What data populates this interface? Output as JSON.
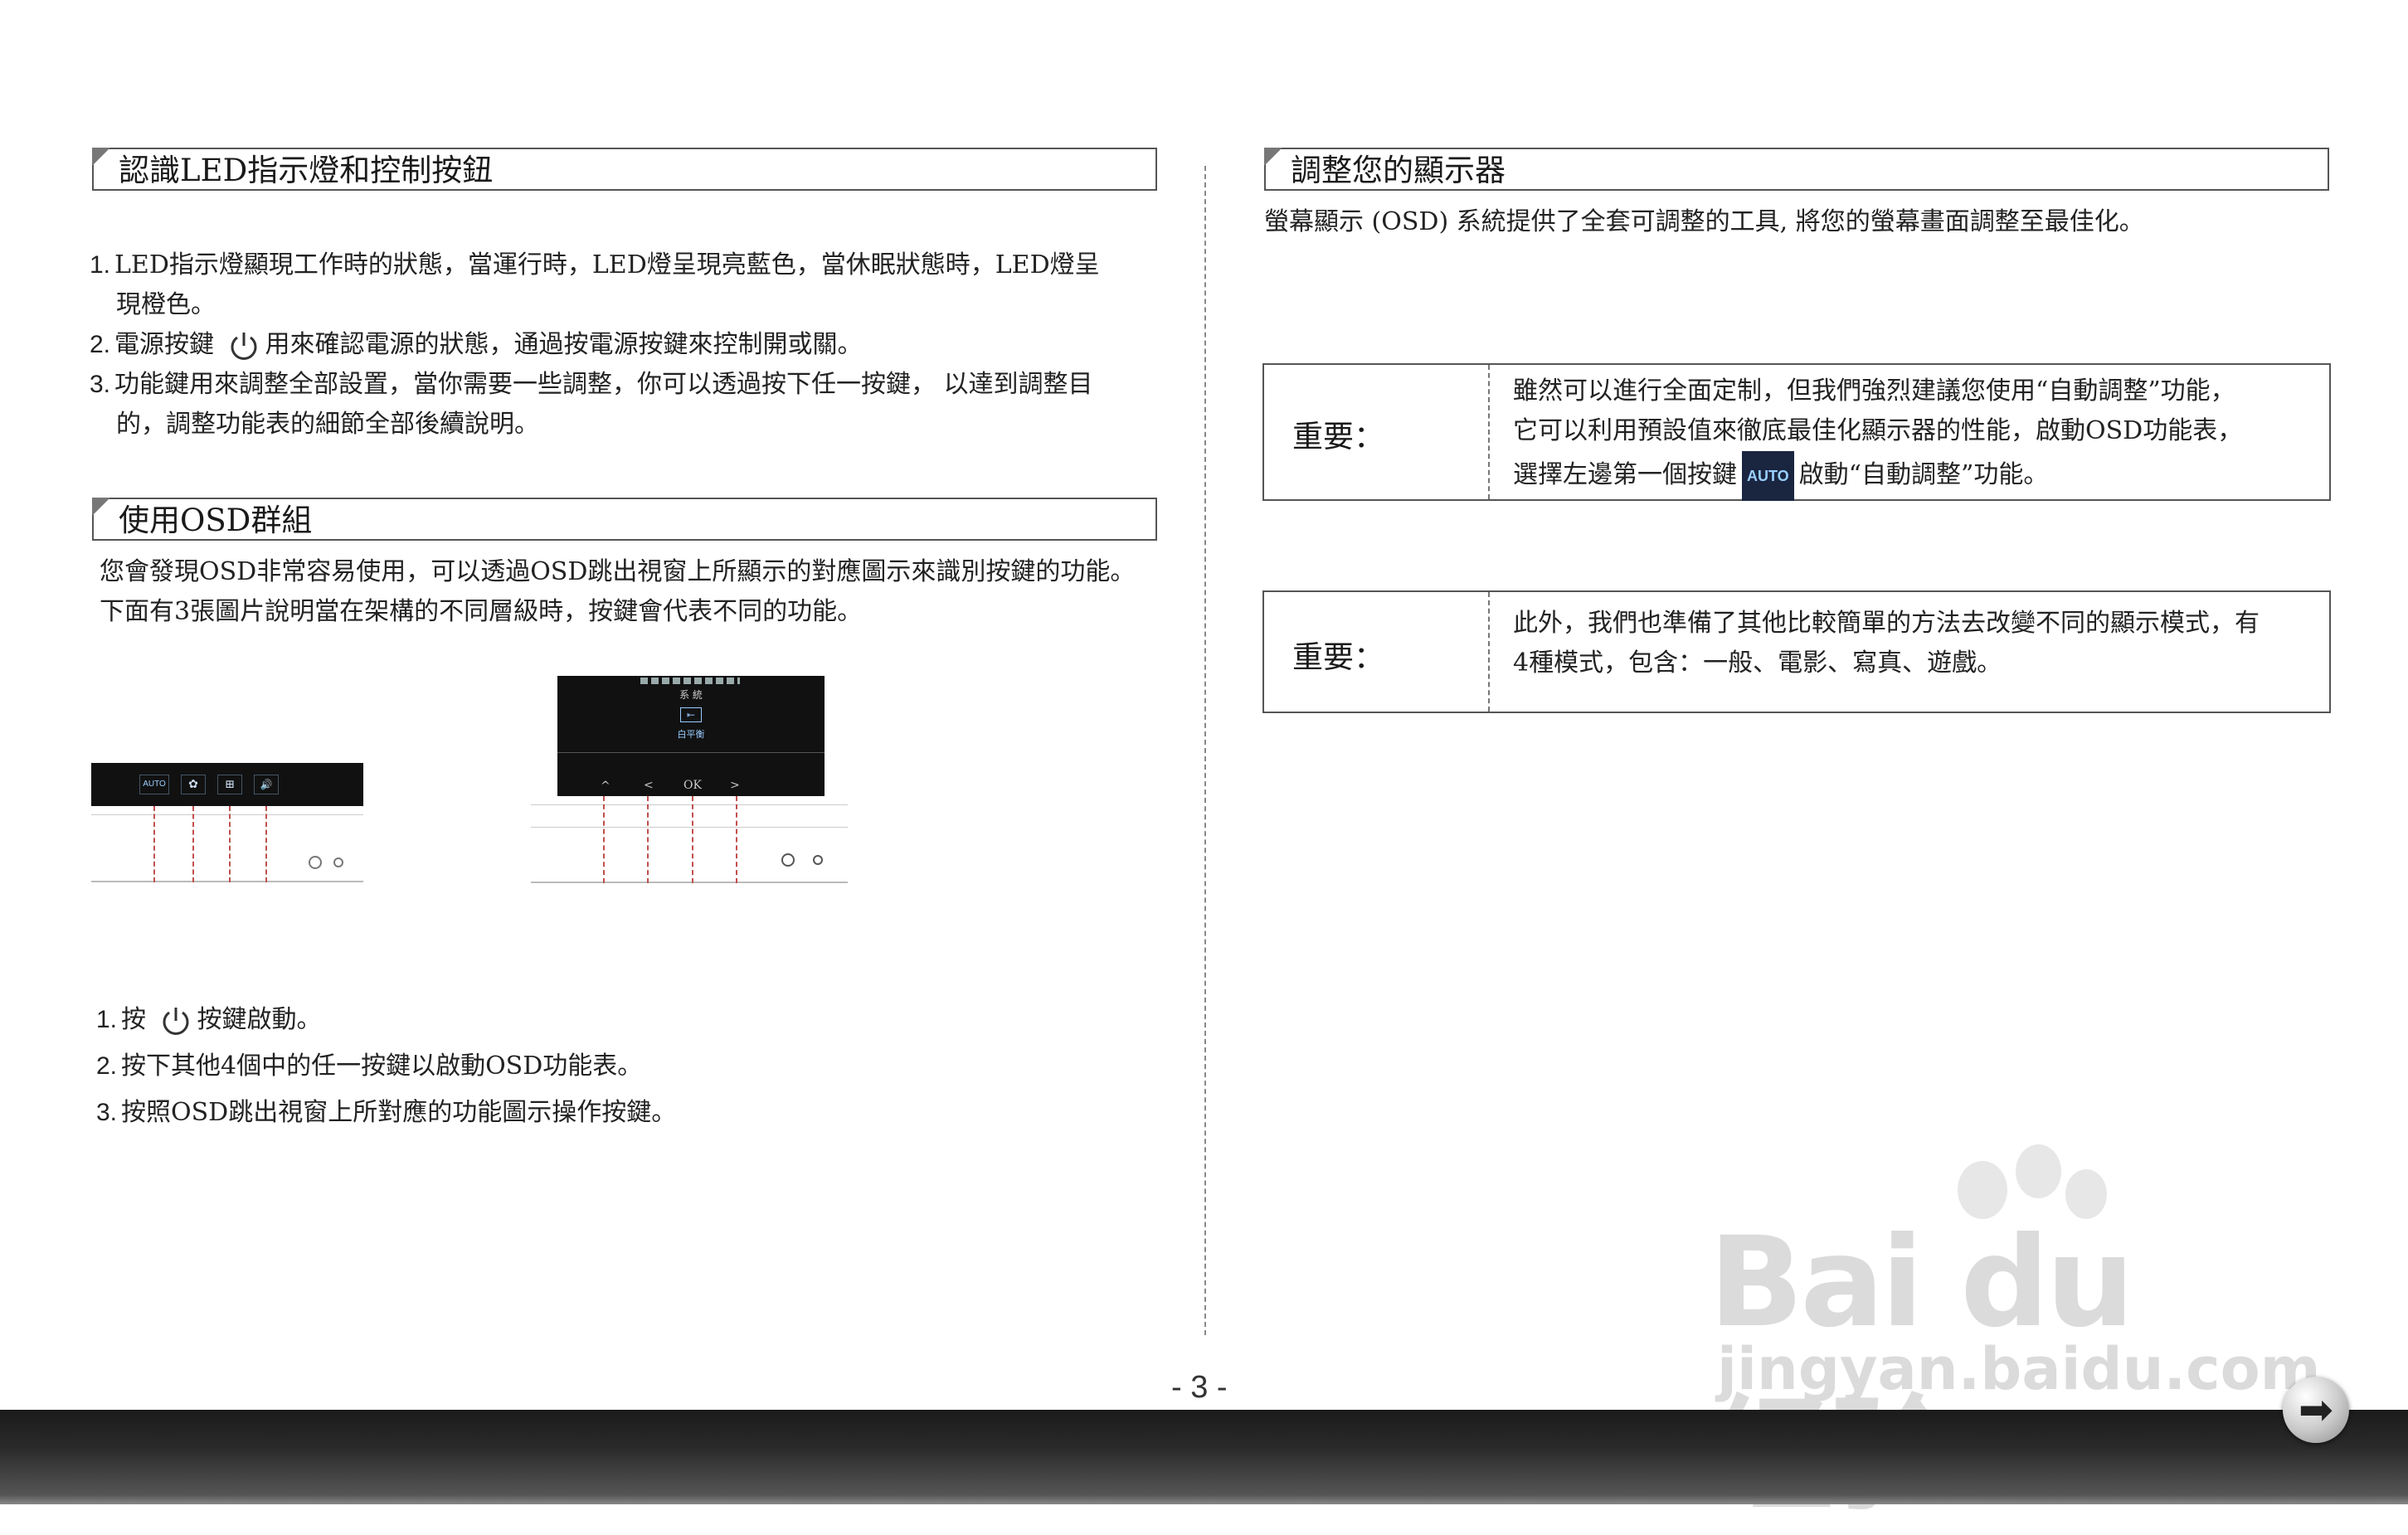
{
  "left": {
    "section1_title": "認識LED指示燈和控制按鈕",
    "s1_item1_num": "1.",
    "s1_item1_line1": "LED指示燈顯現工作時的狀態，當運行時，LED燈呈現亮藍色，當休眠狀態時，LED燈呈",
    "s1_item1_line2": "現橙色。",
    "s1_item2_num": "2.",
    "s1_item2_pre": "電源按鍵",
    "s1_item2_post": "用來確認電源的狀態，通過按電源按鍵來控制開或關。",
    "s1_item3_num": "3.",
    "s1_item3_line1": "功能鍵用來調整全部設置，當你需要一些調整，你可以透過按下任一按鍵， 以達到調整目",
    "s1_item3_line2": "的，調整功能表的細節全部後續說明。",
    "section2_title": "使用OSD群組",
    "s2_line1": "您會發現OSD非常容易使用，可以透過OSD跳出視窗上所顯示的對應圖示來識別按鍵的功能。",
    "s2_line2": "下面有3張圖片說明當在架構的不同層級時，按鍵會代表不同的功能。",
    "fig1_keys": [
      "AUTO",
      "✿",
      "⊞",
      "🔊"
    ],
    "fig2_menu_title": "系 統",
    "fig2_menu_item": "白平衡",
    "fig2_keys": [
      "^",
      "<",
      "OK",
      ">"
    ],
    "steps": [
      {
        "num": "1.",
        "pre": "按",
        "post": "按鍵啟動。"
      },
      {
        "num": "2.",
        "text": "按下其他4個中的任一按鍵以啟動OSD功能表。"
      },
      {
        "num": "3.",
        "text": "按照OSD跳出視窗上所對應的功能圖示操作按鍵。"
      }
    ]
  },
  "right": {
    "section_title": "調整您的顯示器",
    "intro": "螢幕顯示 (OSD) 系統提供了全套可調整的工具, 將您的螢幕畫面調整至最佳化。",
    "box1_label": "重要：",
    "box1_line1": "雖然可以進行全面定制，但我們強烈建議您使用“自動調整”功能，",
    "box1_line2": "它可以利用預設值來徹底最佳化顯示器的性能，啟動OSD功能表，",
    "box1_line3_pre": "選擇左邊第一個按鍵",
    "box1_auto": "AUTO",
    "box1_line3_post": "啟動“自動調整”功能。",
    "box2_label": "重要：",
    "box2_line1": "此外，我們也準備了其他比較簡單的方法去改變不同的顯示模式，有",
    "box2_line2": "4種模式，包含：一般、電影、寫真、遊戲。"
  },
  "page_number": "- 3 -",
  "watermark": {
    "brand": "Bai du 经验",
    "url": "jingyan.baidu.com"
  }
}
